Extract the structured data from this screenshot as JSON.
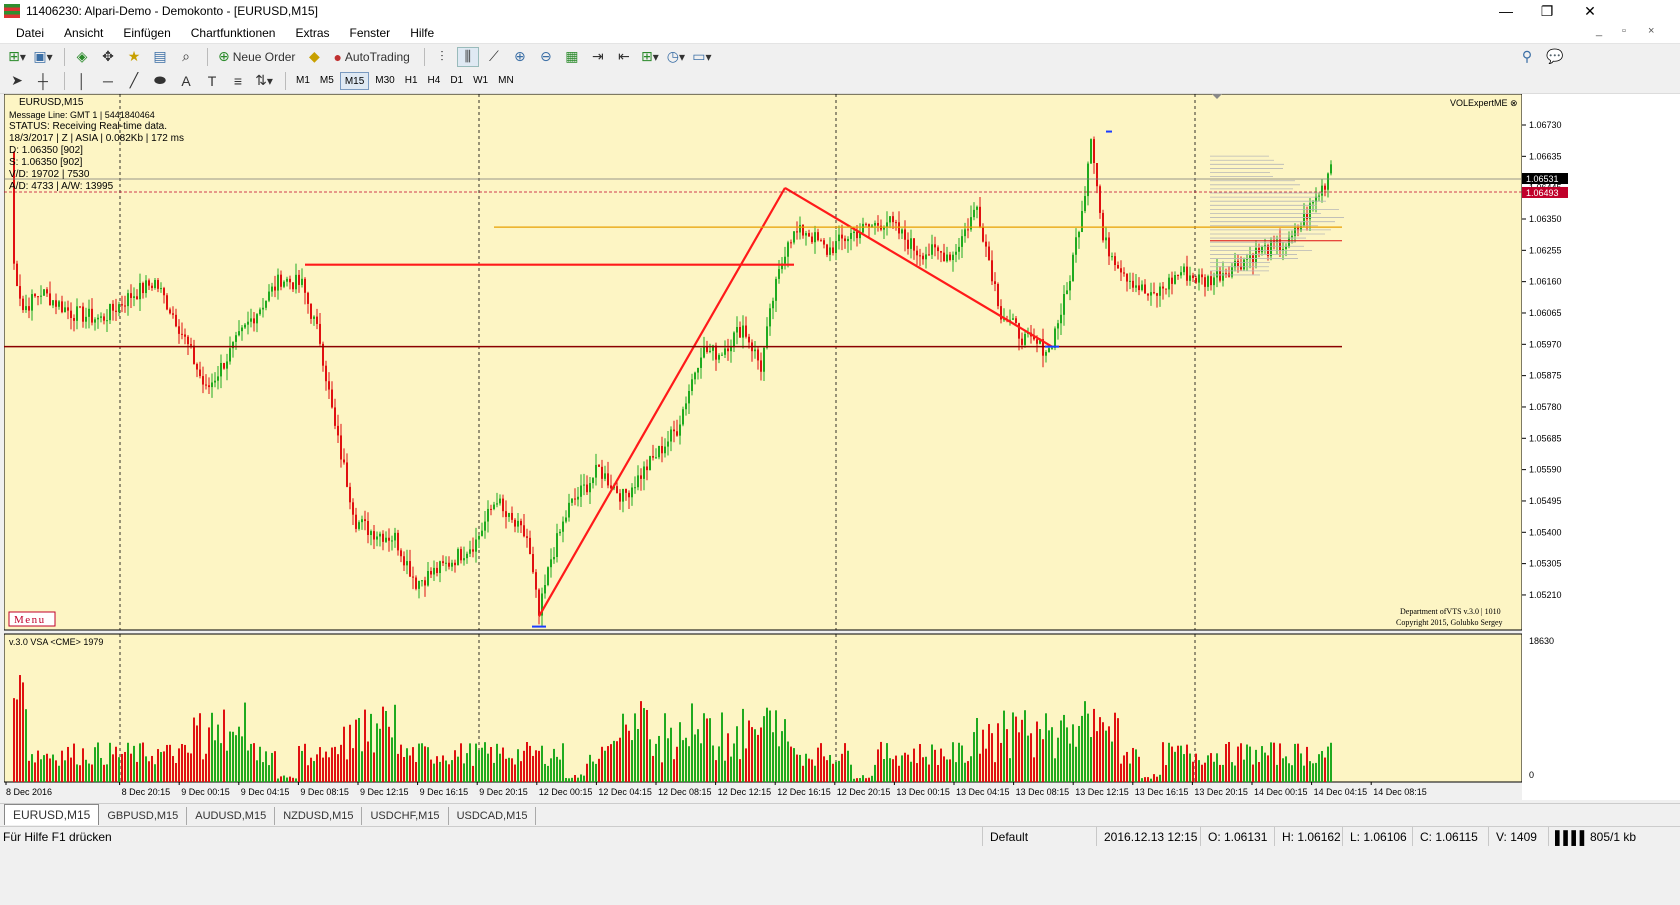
{
  "window": {
    "title": "11406230: Alpari-Demo - Demokonto - [EURUSD,M15]",
    "controls": [
      "—",
      "❐",
      "✕"
    ],
    "mdi_controls": [
      "_",
      "▫",
      "×"
    ]
  },
  "menu": [
    "Datei",
    "Ansicht",
    "Einfügen",
    "Chartfunktionen",
    "Extras",
    "Fenster",
    "Hilfe"
  ],
  "toolbar": {
    "new_order": "Neue Order",
    "auto_trading": "AutoTrading"
  },
  "timeframes": [
    "M1",
    "M5",
    "M15",
    "M30",
    "H1",
    "H4",
    "D1",
    "W1",
    "MN"
  ],
  "selected_timeframe": "M15",
  "chart": {
    "symbol_label": "EURUSD,M15",
    "info_lines": [
      "Message Line: GMT 1 | 5441840464",
      "STATUS:  Receiving Real-time data.",
      "18/3/2017 | Z | ASIA | 0.082Kb | 172 ms",
      "D: 1.06350  [902]",
      "S: 1.06350  [902]",
      "V/D: 19702 | 7530",
      "A/D: 4733 | A/W: 13995"
    ],
    "indicator_name": "VOLExpertME",
    "menu_button": "Menu",
    "copyright_1": "Department ofVTS  v.3.0 | 1010",
    "copyright_2": "Copyright 2015, Golubko Sergey",
    "volume_label": "v.3.0 VSA <CME> 1979",
    "volume_max": "18630",
    "volume_min": "0",
    "price_ticks": [
      "1.06730",
      "1.06635",
      "1.06445",
      "1.06350",
      "1.06255",
      "1.06160",
      "1.06065",
      "1.05970",
      "1.05875",
      "1.05780",
      "1.05685",
      "1.05590",
      "1.05495",
      "1.05400",
      "1.05305",
      "1.05210"
    ],
    "bid_label": "1.06531",
    "ask_label": "1.06493",
    "time_ticks": [
      "8 Dec 2016",
      "8 Dec 20:15",
      "9 Dec 00:15",
      "9 Dec 04:15",
      "9 Dec 08:15",
      "9 Dec 12:15",
      "9 Dec 16:15",
      "9 Dec 20:15",
      "12 Dec 00:15",
      "12 Dec 04:15",
      "12 Dec 08:15",
      "12 Dec 12:15",
      "12 Dec 16:15",
      "12 Dec 20:15",
      "13 Dec 00:15",
      "13 Dec 04:15",
      "13 Dec 08:15",
      "13 Dec 12:15",
      "13 Dec 16:15",
      "13 Dec 20:15",
      "14 Dec 00:15",
      "14 Dec 04:15",
      "14 Dec 08:15"
    ],
    "colors": {
      "background": "#fdf5c4",
      "bull": "#1faa1f",
      "bear": "#e01010",
      "trendline": "#ff1a1a",
      "support": "#8b0000",
      "orange": "#e8a000",
      "bid": "#000000",
      "ask": "#c0002a"
    }
  },
  "tabs": [
    "EURUSD,M15",
    "GBPUSD,M15",
    "AUDUSD,M15",
    "NZDUSD,M15",
    "USDCHF,M15",
    "USDCAD,M15"
  ],
  "status": {
    "help": "Für Hilfe F1 drücken",
    "profile": "Default",
    "datetime": "2016.12.13 12:15",
    "open": "O: 1.06131",
    "high": "H: 1.06162",
    "low": "L: 1.06106",
    "close": "C: 1.06115",
    "volume": "V: 1409",
    "traffic": "805/1 kb"
  },
  "chart_data": {
    "type": "candlestick",
    "ylim": [
      1.0521,
      1.0678
    ],
    "close_path": [
      [
        0,
        1.0661
      ],
      [
        1,
        1.0628
      ],
      [
        4,
        1.0615
      ],
      [
        10,
        1.062
      ],
      [
        20,
        1.0614
      ],
      [
        30,
        1.0612
      ],
      [
        40,
        1.0619
      ],
      [
        48,
        1.0623
      ],
      [
        55,
        1.0612
      ],
      [
        60,
        1.0602
      ],
      [
        65,
        1.0591
      ],
      [
        70,
        1.0598
      ],
      [
        80,
        1.0612
      ],
      [
        90,
        1.0624
      ],
      [
        97,
        1.0622
      ],
      [
        103,
        1.0606
      ],
      [
        108,
        1.058
      ],
      [
        115,
        1.0553
      ],
      [
        120,
        1.055
      ],
      [
        128,
        1.0548
      ],
      [
        135,
        1.0535
      ],
      [
        145,
        1.054
      ],
      [
        155,
        1.0547
      ],
      [
        162,
        1.056
      ],
      [
        164,
        1.0555
      ],
      [
        172,
        1.0548
      ],
      [
        176,
        1.0525
      ],
      [
        180,
        1.0542
      ],
      [
        186,
        1.0557
      ],
      [
        196,
        1.0568
      ],
      [
        204,
        1.056
      ],
      [
        214,
        1.0571
      ],
      [
        222,
        1.058
      ],
      [
        230,
        1.0603
      ],
      [
        236,
        1.0602
      ],
      [
        244,
        1.061
      ],
      [
        250,
        1.0598
      ],
      [
        254,
        1.0618
      ],
      [
        259,
        1.0636
      ],
      [
        265,
        1.0638
      ],
      [
        272,
        1.0632
      ],
      [
        280,
        1.0637
      ],
      [
        292,
        1.0641
      ],
      [
        302,
        1.0632
      ],
      [
        314,
        1.0631
      ],
      [
        322,
        1.0645
      ],
      [
        330,
        1.0614
      ],
      [
        338,
        1.0606
      ],
      [
        346,
        1.0603
      ],
      [
        352,
        1.062
      ],
      [
        358,
        1.065
      ],
      [
        360,
        1.0667
      ],
      [
        364,
        1.0635
      ],
      [
        372,
        1.0625
      ],
      [
        380,
        1.0618
      ],
      [
        390,
        1.0626
      ],
      [
        398,
        1.0623
      ],
      [
        406,
        1.0627
      ],
      [
        416,
        1.0632
      ],
      [
        426,
        1.0634
      ],
      [
        438,
        1.0652
      ],
      [
        440,
        1.0658
      ]
    ],
    "annotations": {
      "trendline_1": [
        [
          176,
          1.0525
        ],
        [
          258,
          1.06505
        ]
      ],
      "trendline_2": [
        [
          258,
          1.06505
        ],
        [
          347,
          1.0604
        ]
      ],
      "horizontal_resistance": 1.0628,
      "horizontal_support": 1.0604,
      "orange_level": 1.0639,
      "bid": 1.06531,
      "ask": 1.06493
    }
  }
}
